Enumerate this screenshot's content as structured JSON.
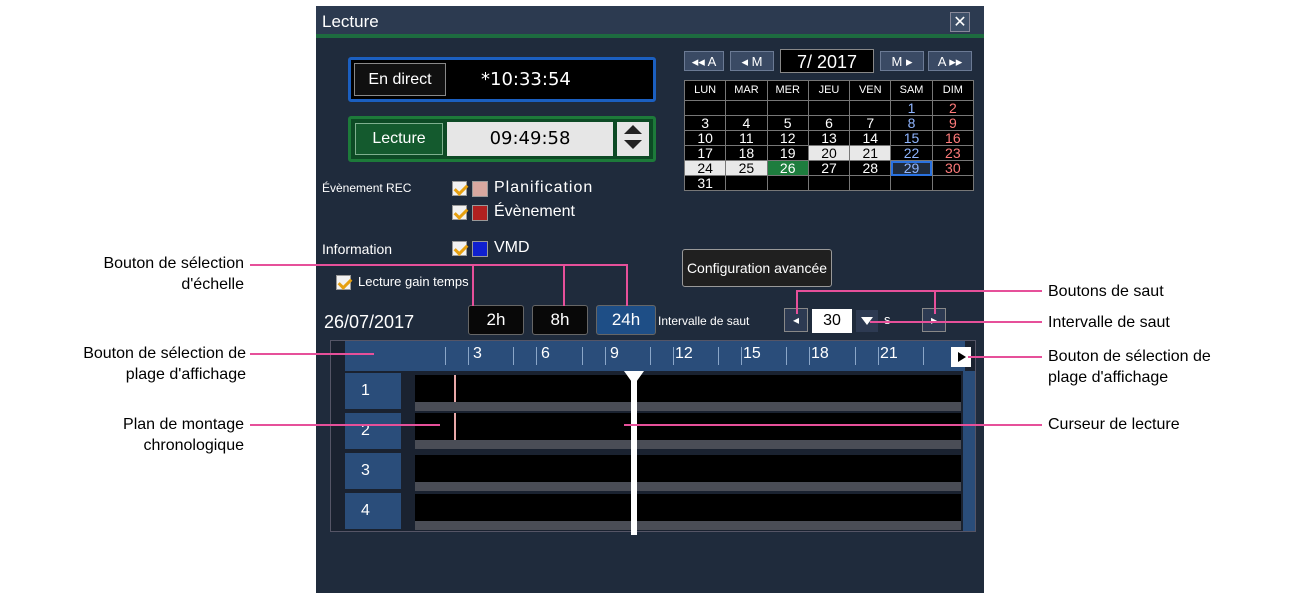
{
  "window": {
    "title": "Lecture",
    "close_glyph": "✕"
  },
  "live": {
    "button_label": "En direct",
    "time": "*10:33:54"
  },
  "playback": {
    "button_label": "Lecture",
    "time": "09:49:58"
  },
  "rec_event": {
    "label": "Évènement REC",
    "schedule_label": "Planification",
    "schedule_color": "#d8a8a0",
    "event_label": "Évènement",
    "event_color": "#b02020"
  },
  "information": {
    "label": "Information",
    "vmd_label": "VMD",
    "vmd_color": "#1020d0"
  },
  "time_lapse": {
    "label": "Lecture gain temps"
  },
  "calendar": {
    "nav_prev_year": "◂◂ A",
    "nav_prev_month": "◂ M",
    "month_year": "7/ 2017",
    "nav_next_month": "M ▸",
    "nav_next_year": "A ▸▸",
    "weekdays": [
      "LUN",
      "MAR",
      "MER",
      "JEU",
      "VEN",
      "SAM",
      "DIM"
    ],
    "weeks": [
      [
        "",
        "",
        "",
        "",
        "",
        "1",
        "2"
      ],
      [
        "3",
        "4",
        "5",
        "6",
        "7",
        "8",
        "9"
      ],
      [
        "10",
        "11",
        "12",
        "13",
        "14",
        "15",
        "16"
      ],
      [
        "17",
        "18",
        "19",
        "20",
        "21",
        "22",
        "23"
      ],
      [
        "24",
        "25",
        "26",
        "27",
        "28",
        "29",
        "30"
      ],
      [
        "31",
        "",
        "",
        "",
        "",
        "",
        ""
      ]
    ]
  },
  "advanced_button": "Configuration avancée",
  "timeline": {
    "date": "26/07/2017",
    "scales": [
      "2h",
      "8h",
      "24h"
    ],
    "active_scale": "24h",
    "jump_label": "Intervalle de saut",
    "jump_back": "◂",
    "jump_value": "30",
    "jump_unit": "s",
    "jump_forward": "▸",
    "hour_labels": [
      "3",
      "6",
      "9",
      "12",
      "15",
      "18",
      "21"
    ],
    "cameras": [
      "1",
      "2",
      "3",
      "4"
    ]
  },
  "callouts": {
    "scale_select": "Bouton de sélection\nd'échelle",
    "range_left": "Bouton de sélection de\nplage d'affichage",
    "timeline_plan": "Plan de montage\nchronologique",
    "jump_buttons": "Boutons de saut",
    "jump_interval": "Intervalle de saut",
    "range_right": "Bouton de sélection de\nplage d'affichage",
    "cursor": "Curseur de lecture"
  }
}
